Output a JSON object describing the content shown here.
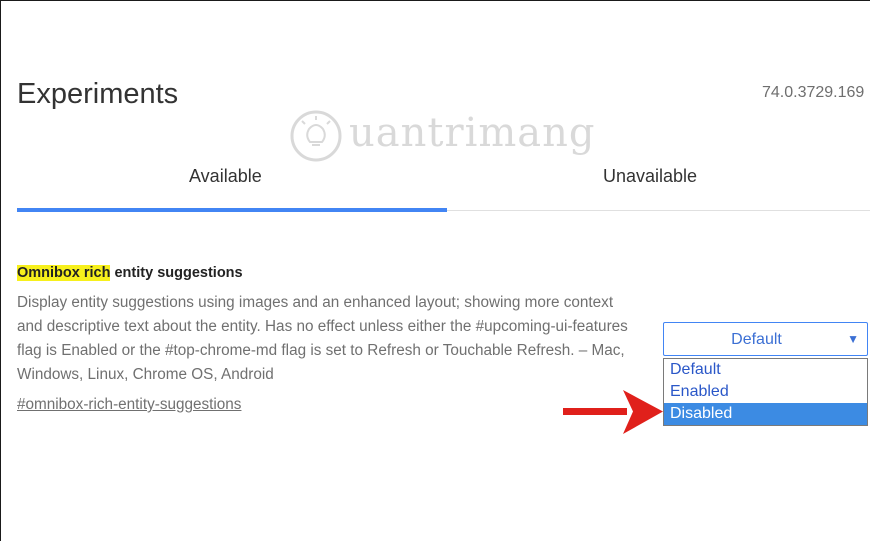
{
  "header": {
    "title": "Experiments",
    "version": "74.0.3729.169"
  },
  "watermark": {
    "text": "uantrimang"
  },
  "tabs": [
    {
      "label": "Available",
      "selected": true
    },
    {
      "label": "Unavailable",
      "selected": false
    }
  ],
  "flag": {
    "title_highlight": "Omnibox rich",
    "title_rest": " entity suggestions",
    "description": "Display entity suggestions using images and an enhanced layout; showing more context and descriptive text about the entity. Has no effect unless either the #upcoming-ui-features flag is Enabled or the #top-chrome-md flag is set to Refresh or Touchable Refresh. – Mac, Windows, Linux, Chrome OS, Android",
    "link": "#omnibox-rich-entity-suggestions",
    "select": {
      "value": "Default",
      "caret": "▼",
      "options": [
        "Default",
        "Enabled",
        "Disabled"
      ],
      "highlighted": "Disabled"
    }
  },
  "colors": {
    "accent": "#4285f4",
    "highlight": "#f7f01c",
    "selected_option": "#3c8be3",
    "arrow": "#e0201b"
  },
  "icons": {
    "watermark_logo": "lightbulb-icon",
    "pointer": "red-arrow-icon"
  }
}
